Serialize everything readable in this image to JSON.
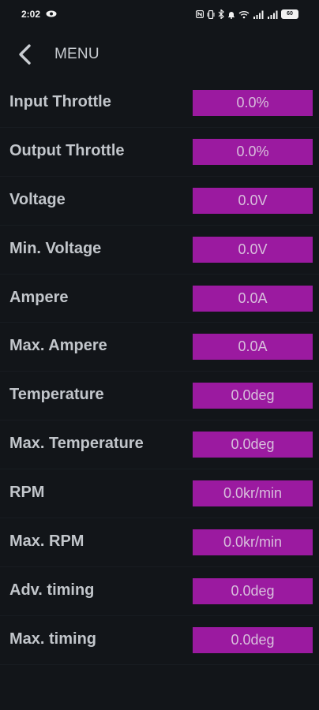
{
  "status_bar": {
    "time": "2:02",
    "battery": "60",
    "eye_icon": "eye-icon",
    "icons": [
      "nfc-icon",
      "vibrate-icon",
      "bluetooth-icon",
      "bell-icon",
      "wifi-icon",
      "signal-icon",
      "signal-icon-2",
      "battery-icon"
    ]
  },
  "header": {
    "back_icon": "chevron-left-icon",
    "title": "MENU"
  },
  "colors": {
    "background": "#121519",
    "value_box": "#9b1aa0",
    "value_text": "#d8bfdc",
    "label_text": "#c2c6cb"
  },
  "rows": [
    {
      "label": "Input Throttle",
      "value": "0.0%"
    },
    {
      "label": "Output Throttle",
      "value": "0.0%"
    },
    {
      "label": "Voltage",
      "value": "0.0V"
    },
    {
      "label": "Min. Voltage",
      "value": "0.0V"
    },
    {
      "label": "Ampere",
      "value": "0.0A"
    },
    {
      "label": "Max. Ampere",
      "value": "0.0A"
    },
    {
      "label": "Temperature",
      "value": "0.0deg"
    },
    {
      "label": "Max. Temperature",
      "value": "0.0deg"
    },
    {
      "label": "RPM",
      "value": "0.0kr/min"
    },
    {
      "label": "Max. RPM",
      "value": "0.0kr/min"
    },
    {
      "label": "Adv. timing",
      "value": "0.0deg"
    },
    {
      "label": "Max. timing",
      "value": "0.0deg"
    }
  ]
}
